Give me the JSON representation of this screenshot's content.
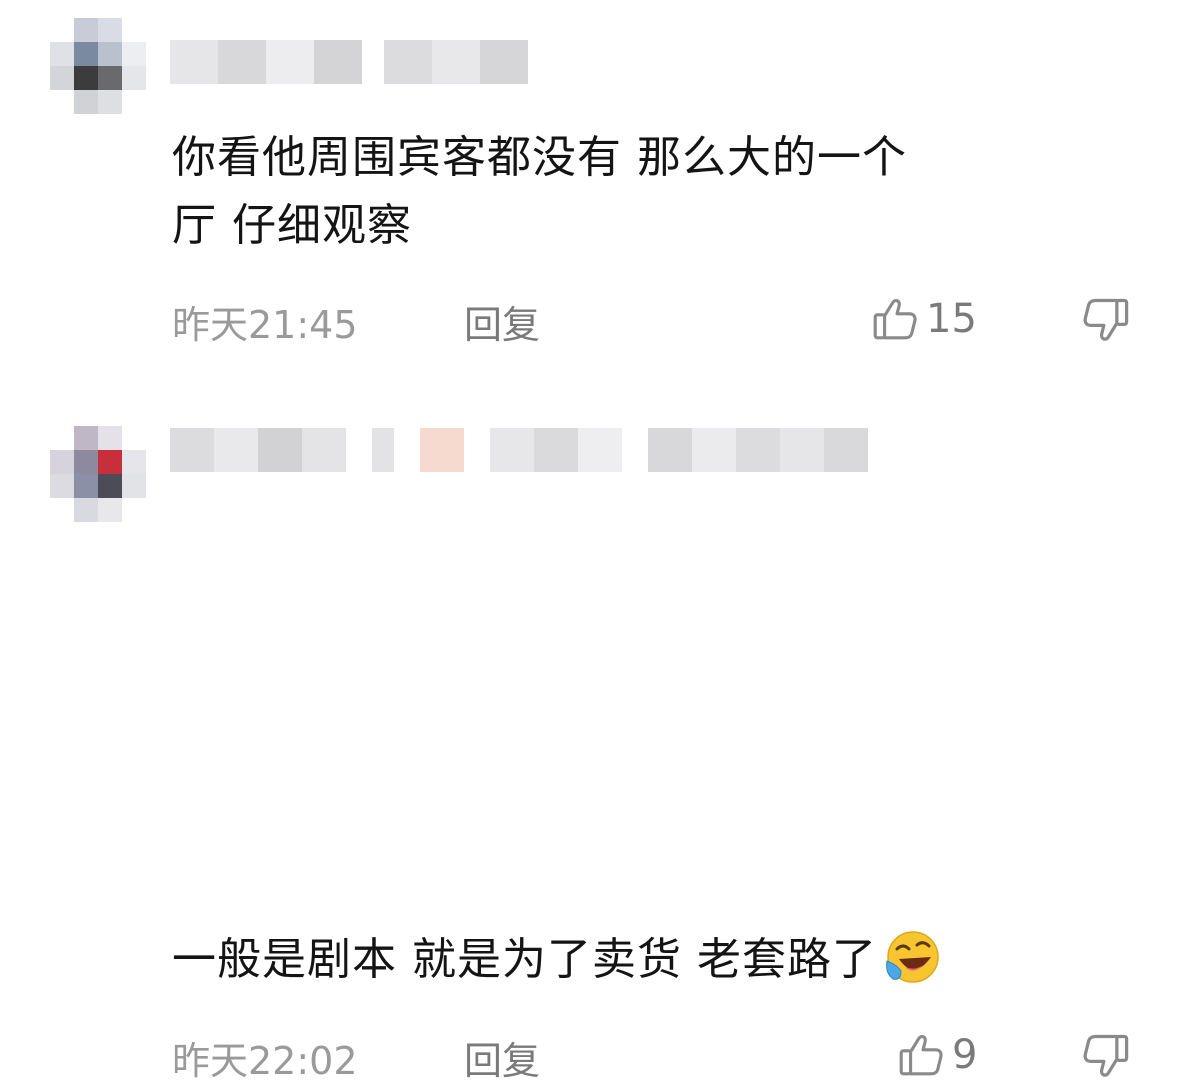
{
  "comments": [
    {
      "text_line1": "你看他周围宾客都没有 那么大的一个",
      "text_line2": "厅 仔细观察",
      "time": "昨天21:45",
      "reply_label": "回复",
      "like_count": "15"
    },
    {
      "text": "一般是剧本 就是为了卖货 老套路了",
      "emoji": "laughing-tears-emoji",
      "time": "昨天22:02",
      "reply_label": "回复",
      "like_count": "9"
    }
  ],
  "colors": {
    "meta_text": "#9a9a9a",
    "icon_stroke": "#8a8a8a",
    "emoji_face": "#f7c530"
  }
}
